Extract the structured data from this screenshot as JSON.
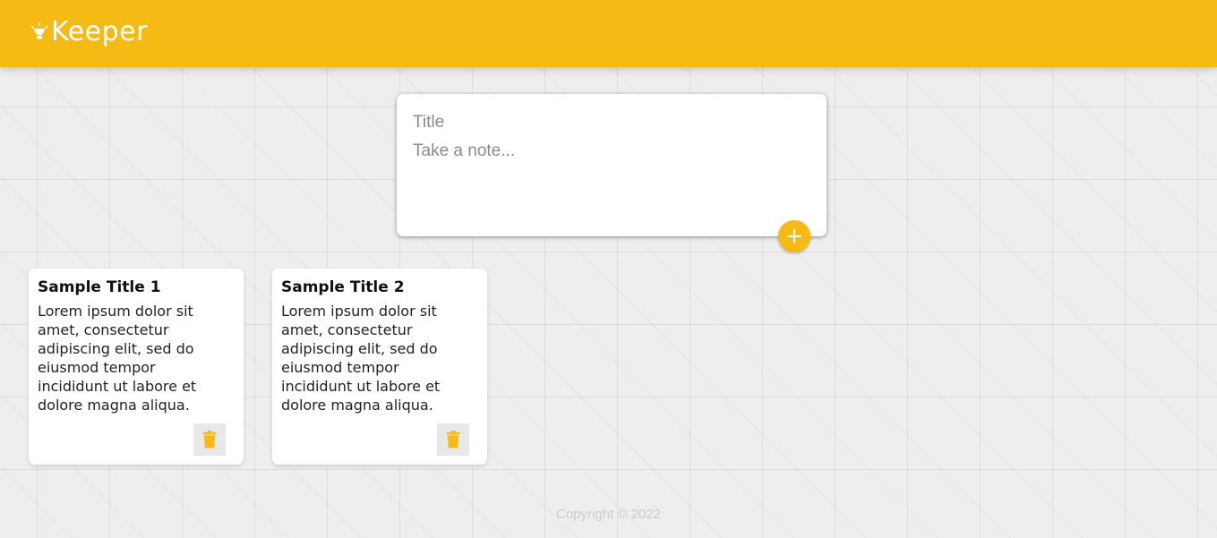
{
  "header": {
    "icon": "lightbulb-icon",
    "title": "Keeper"
  },
  "create_note": {
    "title_placeholder": "Title",
    "content_placeholder": "Take a note...",
    "add_icon": "plus-icon"
  },
  "notes": [
    {
      "title": "Sample Title 1",
      "content": "Lorem ipsum dolor sit amet, consectetur adipiscing elit, sed do eiusmod tempor incididunt ut labore et dolore magna aliqua.",
      "delete_icon": "trash-icon"
    },
    {
      "title": "Sample Title 2",
      "content": "Lorem ipsum dolor sit amet, consectetur adipiscing elit, sed do eiusmod tempor incididunt ut labore et dolore magna aliqua.",
      "delete_icon": "trash-icon"
    }
  ],
  "footer": {
    "copyright": "Copyright © 2022"
  },
  "colors": {
    "accent": "#f5ba13",
    "background": "#eeeeee",
    "card": "#ffffff"
  }
}
